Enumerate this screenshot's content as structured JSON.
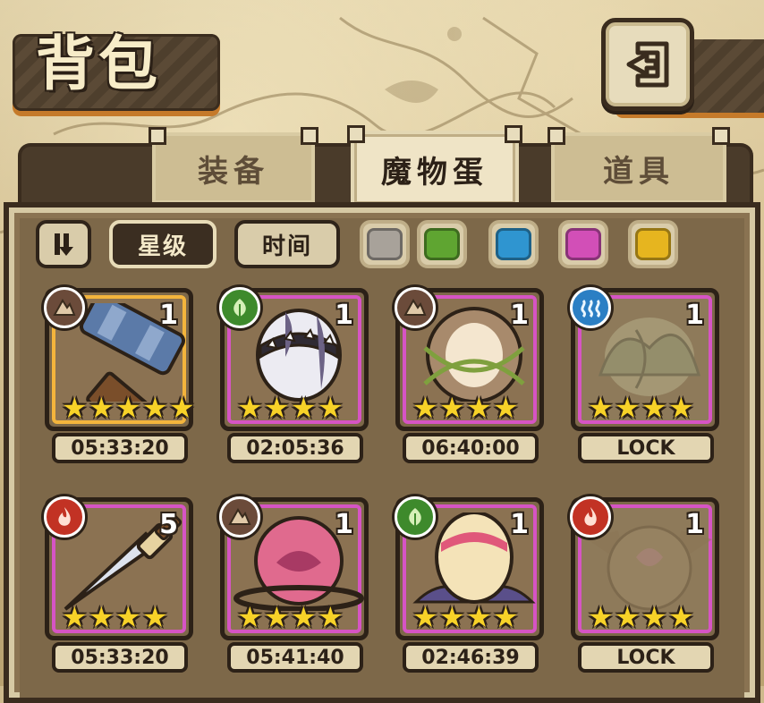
{
  "header": {
    "title": "背包"
  },
  "tabs": [
    {
      "label": "装备",
      "active": false
    },
    {
      "label": "魔物蛋",
      "active": true
    },
    {
      "label": "道具",
      "active": false
    }
  ],
  "filters": {
    "sort_icon": "sort-toggle-icon",
    "star_label": "星级",
    "time_label": "时间",
    "colors": [
      "#a8a29a",
      "#5fa531",
      "#2f95d0",
      "#d24fb7",
      "#e6b51f"
    ]
  },
  "items": [
    {
      "element": "earth",
      "count": "1",
      "stars": 5,
      "timer": "05:33:20",
      "rarity": "gold",
      "art": "hammer"
    },
    {
      "element": "nature",
      "count": "1",
      "stars": 4,
      "timer": "02:05:36",
      "rarity": "purple",
      "art": "spiked-egg"
    },
    {
      "element": "earth",
      "count": "1",
      "stars": 4,
      "timer": "06:40:00",
      "rarity": "purple",
      "art": "furry-egg"
    },
    {
      "element": "water",
      "count": "1",
      "stars": 4,
      "timer": "LOCK",
      "rarity": "purple",
      "art": "leaf-egg-locked"
    },
    {
      "element": "fire",
      "count": "5",
      "stars": 4,
      "timer": "05:33:20",
      "rarity": "purple",
      "art": "dagger"
    },
    {
      "element": "earth",
      "count": "1",
      "stars": 4,
      "timer": "05:41:40",
      "rarity": "purple",
      "art": "thorn-egg"
    },
    {
      "element": "nature",
      "count": "1",
      "stars": 4,
      "timer": "02:46:39",
      "rarity": "purple",
      "art": "feather-egg"
    },
    {
      "element": "fire",
      "count": "1",
      "stars": 4,
      "timer": "LOCK",
      "rarity": "purple",
      "art": "bat-egg-locked"
    }
  ]
}
